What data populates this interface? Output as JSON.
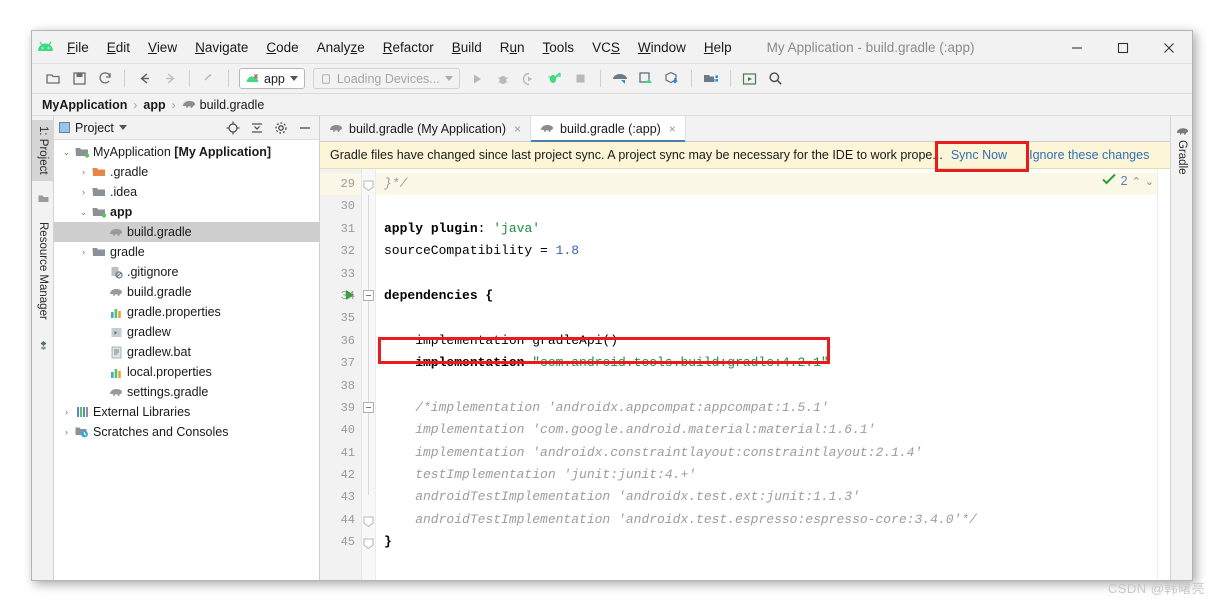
{
  "window": {
    "title": "My Application - build.gradle (:app)",
    "logo_icon": "android-logo-icon",
    "controls": [
      {
        "name": "minimize-button",
        "glyph": "minimize-icon"
      },
      {
        "name": "maximize-button",
        "glyph": "maximize-icon"
      },
      {
        "name": "close-button",
        "glyph": "close-icon"
      }
    ]
  },
  "menu": [
    {
      "label": "File",
      "mnemonic": "F"
    },
    {
      "label": "Edit",
      "mnemonic": "E"
    },
    {
      "label": "View",
      "mnemonic": "V"
    },
    {
      "label": "Navigate",
      "mnemonic": "N"
    },
    {
      "label": "Code",
      "mnemonic": "C"
    },
    {
      "label": "Analyze",
      "mnemonic": "z"
    },
    {
      "label": "Refactor",
      "mnemonic": "R"
    },
    {
      "label": "Build",
      "mnemonic": "B"
    },
    {
      "label": "Run",
      "mnemonic": "u"
    },
    {
      "label": "Tools",
      "mnemonic": "T"
    },
    {
      "label": "VCS",
      "mnemonic": "S"
    },
    {
      "label": "Window",
      "mnemonic": "W"
    },
    {
      "label": "Help",
      "mnemonic": "H"
    }
  ],
  "toolbar": {
    "icons_left": [
      "open-folder-icon",
      "save-icon",
      "sync-refresh-icon"
    ],
    "nav_icons": [
      "back-arrow-icon",
      "forward-arrow-icon",
      "up-arrow-icon"
    ],
    "run_config": "app",
    "device_selector": "Loading Devices...",
    "icons_right": [
      "run-icon",
      "debug-icon",
      "run-coverage-icon",
      "profile-icon",
      "stop-icon",
      "avd-manager-icon",
      "sdk-manager-icon",
      "gradle-sync-icon",
      "project-structure-icon",
      "layout-inspector-icon",
      "search-icon"
    ]
  },
  "breadcrumb": {
    "items": [
      {
        "label": "MyApplication",
        "bold": true,
        "icon": ""
      },
      {
        "label": "app",
        "bold": true,
        "icon": ""
      },
      {
        "label": "build.gradle",
        "bold": false,
        "icon": "gradle-elephant-icon"
      }
    ],
    "separator": "›"
  },
  "left_strip": {
    "tabs": [
      {
        "label": "1: Project",
        "icon": "project-icon",
        "active": true
      },
      {
        "label": "Resource Manager",
        "icon": "resource-manager-icon",
        "active": false
      }
    ]
  },
  "right_strip": {
    "tabs": [
      {
        "label": "Gradle",
        "icon": "gradle-elephant-icon"
      }
    ]
  },
  "project_panel": {
    "title": "Project",
    "dropdown_icon": "chevron-down-icon",
    "actions": [
      "locate-icon",
      "collapse-all-icon",
      "settings-gear-icon",
      "hide-icon"
    ],
    "tree": [
      {
        "indent": 0,
        "arrow": "⌄",
        "icon": "module-folder-icon",
        "label": "MyApplication",
        "suffix": " [My Application]",
        "bold_suffix": true,
        "selected": false
      },
      {
        "indent": 1,
        "arrow": "›",
        "icon": "folder-orange-icon",
        "label": ".gradle",
        "suffix": "",
        "selected": false
      },
      {
        "indent": 1,
        "arrow": "›",
        "icon": "folder-gray-icon",
        "label": ".idea",
        "suffix": "",
        "selected": false
      },
      {
        "indent": 1,
        "arrow": "⌄",
        "icon": "module-folder-icon",
        "label": "app",
        "suffix": "",
        "bold_label": true,
        "selected": false
      },
      {
        "indent": 2,
        "arrow": "",
        "icon": "gradle-elephant-icon",
        "label": "build.gradle",
        "suffix": "",
        "selected": true
      },
      {
        "indent": 1,
        "arrow": "›",
        "icon": "folder-gray-icon",
        "label": "gradle",
        "suffix": "",
        "selected": false
      },
      {
        "indent": 2,
        "arrow": "",
        "icon": "gitignore-icon",
        "label": ".gitignore",
        "suffix": "",
        "selected": false
      },
      {
        "indent": 2,
        "arrow": "",
        "icon": "gradle-elephant-icon",
        "label": "build.gradle",
        "suffix": "",
        "selected": false
      },
      {
        "indent": 2,
        "arrow": "",
        "icon": "properties-icon",
        "label": "gradle.properties",
        "suffix": "",
        "selected": false
      },
      {
        "indent": 2,
        "arrow": "",
        "icon": "script-icon",
        "label": "gradlew",
        "suffix": "",
        "selected": false
      },
      {
        "indent": 2,
        "arrow": "",
        "icon": "bat-file-icon",
        "label": "gradlew.bat",
        "suffix": "",
        "selected": false
      },
      {
        "indent": 2,
        "arrow": "",
        "icon": "properties-icon",
        "label": "local.properties",
        "suffix": "",
        "selected": false
      },
      {
        "indent": 2,
        "arrow": "",
        "icon": "gradle-elephant-icon",
        "label": "settings.gradle",
        "suffix": "",
        "selected": false
      },
      {
        "indent": 0,
        "arrow": "›",
        "icon": "external-libraries-icon",
        "label": "External Libraries",
        "suffix": "",
        "selected": false
      },
      {
        "indent": 0,
        "arrow": "›",
        "icon": "scratches-icon",
        "label": "Scratches and Consoles",
        "suffix": "",
        "selected": false
      }
    ]
  },
  "editor": {
    "tabs": [
      {
        "label": "build.gradle (My Application)",
        "icon": "gradle-elephant-icon",
        "active": false,
        "close": "×"
      },
      {
        "label": "build.gradle (:app)",
        "icon": "gradle-elephant-icon",
        "active": true,
        "close": "×"
      }
    ],
    "notification": {
      "text": "Gradle files have changed since last project sync. A project sync may be necessary for the IDE to work prope...",
      "sync_link": "Sync Now",
      "ignore_link": "Ignore these changes"
    },
    "inspection": {
      "icon": "inspection-ok-icon",
      "count": "2",
      "up": "⌃",
      "down": "⌄"
    },
    "line_numbers": [
      "29",
      "30",
      "31",
      "32",
      "33",
      "34",
      "35",
      "36",
      "37",
      "38",
      "39",
      "40",
      "41",
      "42",
      "43",
      "44",
      "45"
    ],
    "code_lines": [
      {
        "num": "29",
        "highlight": true,
        "fold": "end",
        "tokens": [
          {
            "t": "}*/",
            "c": "cmt"
          }
        ]
      },
      {
        "num": "30",
        "highlight": false,
        "tokens": []
      },
      {
        "num": "31",
        "highlight": false,
        "tokens": [
          {
            "t": "apply ",
            "c": "k"
          },
          {
            "t": "plugin",
            "c": "k"
          },
          {
            "t": ": ",
            "c": "plain"
          },
          {
            "t": "'java'",
            "c": "s"
          }
        ]
      },
      {
        "num": "32",
        "highlight": false,
        "tokens": [
          {
            "t": "sourceCompatibility = ",
            "c": "plain"
          },
          {
            "t": "1.8",
            "c": "n"
          }
        ]
      },
      {
        "num": "33",
        "highlight": false,
        "tokens": []
      },
      {
        "num": "34",
        "highlight": false,
        "fold": "start",
        "runmark": true,
        "tokens": [
          {
            "t": "dependencies {",
            "c": "k"
          }
        ]
      },
      {
        "num": "35",
        "highlight": false,
        "tokens": []
      },
      {
        "num": "36",
        "highlight": false,
        "tokens": [
          {
            "t": "    implementation gradleApi()",
            "c": "plain"
          }
        ]
      },
      {
        "num": "37",
        "highlight": false,
        "tokens": [
          {
            "t": "    implementation ",
            "c": "k"
          },
          {
            "t": "\"com.android.tools.build:gradle:4.2.1\"",
            "c": "s"
          }
        ]
      },
      {
        "num": "38",
        "highlight": false,
        "tokens": []
      },
      {
        "num": "39",
        "highlight": false,
        "fold": "start",
        "tokens": [
          {
            "t": "    /*implementation 'androidx.appcompat:appcompat:1.5.1'",
            "c": "cmt"
          }
        ]
      },
      {
        "num": "40",
        "highlight": false,
        "tokens": [
          {
            "t": "    implementation 'com.google.android.material:material:1.6.1'",
            "c": "cmt"
          }
        ]
      },
      {
        "num": "41",
        "highlight": false,
        "tokens": [
          {
            "t": "    implementation 'androidx.constraintlayout:constraintlayout:2.1.4'",
            "c": "cmt"
          }
        ]
      },
      {
        "num": "42",
        "highlight": false,
        "tokens": [
          {
            "t": "    testImplementation 'junit:junit:4.+'",
            "c": "cmt"
          }
        ]
      },
      {
        "num": "43",
        "highlight": false,
        "tokens": [
          {
            "t": "    androidTestImplementation 'androidx.test.ext:junit:1.1.3'",
            "c": "cmt"
          }
        ]
      },
      {
        "num": "44",
        "highlight": false,
        "fold": "end",
        "tokens": [
          {
            "t": "    androidTestImplementation 'androidx.test.espresso:espresso-core:3.4.0'*/",
            "c": "cmt"
          }
        ]
      },
      {
        "num": "45",
        "highlight": false,
        "fold": "end",
        "tokens": [
          {
            "t": "}",
            "c": "k"
          }
        ]
      }
    ]
  },
  "annotations": [
    {
      "name": "sync-now-annotation",
      "target": "Sync Now"
    },
    {
      "name": "implementation-line-annotation",
      "target": "implementation \"com.android.tools.build:gradle:4.2.1\""
    }
  ],
  "watermark": "CSDN @韩曙亮",
  "colors": {
    "accent_blue": "#2e70b8",
    "notification_bg": "#fcf5d8",
    "annotation_red": "#e81c1c",
    "string_green": "#1c8c3c",
    "number_blue": "#3b5fc0",
    "comment_gray": "#9c9c9c",
    "android_green": "#3ddc84"
  }
}
